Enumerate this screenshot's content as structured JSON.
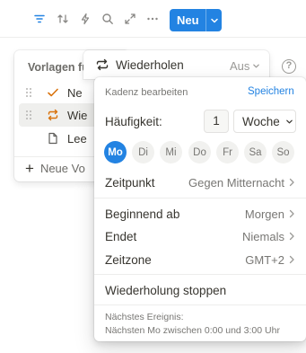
{
  "toolbar": {
    "icons": [
      "filter-icon",
      "sort-icon",
      "automation-icon",
      "search-icon",
      "expand-icon",
      "more-icon"
    ],
    "new_label": "Neu"
  },
  "templates_menu": {
    "title": "Vorlagen fü",
    "items": [
      {
        "label": "Ne",
        "icon": "check-icon"
      },
      {
        "label": "Wie",
        "icon": "repeat-icon"
      },
      {
        "label": "Lee",
        "icon": "page-icon"
      }
    ],
    "new_label": "Neue Vo"
  },
  "repeat_bar": {
    "label": "Wiederholen",
    "value": "Aus"
  },
  "help": {
    "glyph": "?"
  },
  "popover": {
    "title": "Kadenz bearbeiten",
    "save_label": "Speichern",
    "frequency_label": "Häufigkeit:",
    "frequency_value": "1",
    "frequency_unit": "Woche",
    "days": [
      {
        "label": "Mo",
        "selected": true
      },
      {
        "label": "Di",
        "selected": false
      },
      {
        "label": "Mi",
        "selected": false
      },
      {
        "label": "Do",
        "selected": false
      },
      {
        "label": "Fr",
        "selected": false
      },
      {
        "label": "Sa",
        "selected": false
      },
      {
        "label": "So",
        "selected": false
      }
    ],
    "time_label": "Zeitpunkt",
    "time_value": "Gegen Mitternacht",
    "start_label": "Beginnend ab",
    "start_value": "Morgen",
    "end_label": "Endet",
    "end_value": "Niemals",
    "timezone_label": "Zeitzone",
    "timezone_value": "GMT+2",
    "stop_label": "Wiederholung stoppen",
    "next_label": "Nächstes Ereignis:",
    "next_value": "Nächsten Mo zwischen 0:00 und 3:00 Uhr"
  },
  "colors": {
    "accent": "#2383e2",
    "check": "#d9730d",
    "text": "#37352f",
    "muted": "#787774"
  }
}
